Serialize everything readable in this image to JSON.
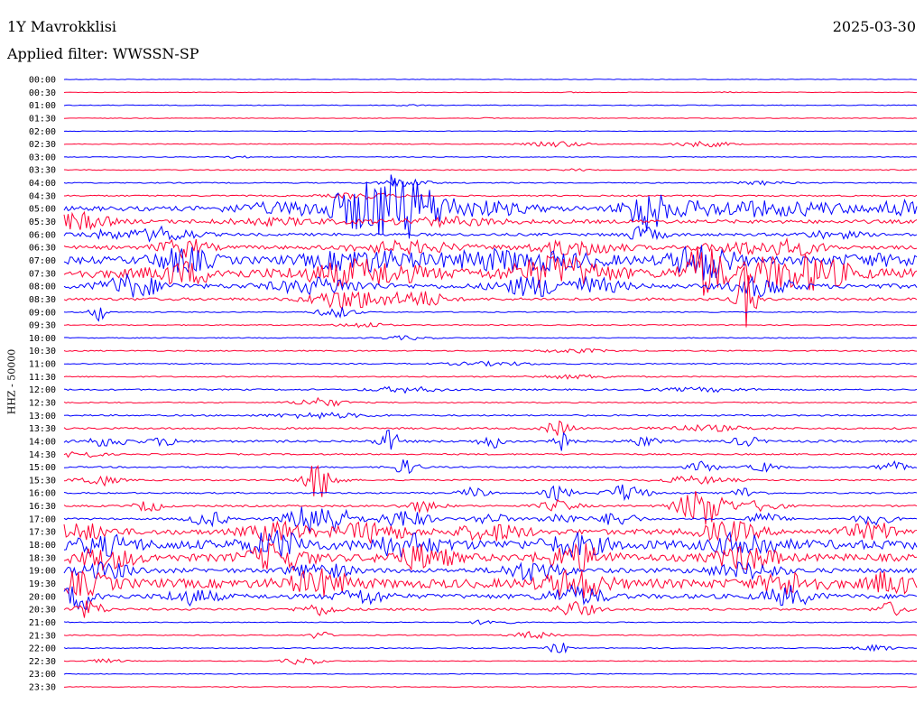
{
  "header": {
    "station": "1Y Mavrokklisi",
    "date": "2025-03-30",
    "filter": "Applied filter: WWSSN-SP"
  },
  "chart_data": {
    "type": "line",
    "ylabel": "HHZ - 50000",
    "tick_labels": [
      "00:00",
      "00:30",
      "01:00",
      "01:30",
      "02:00",
      "02:30",
      "03:00",
      "03:30",
      "04:00",
      "04:30",
      "05:00",
      "05:30",
      "06:00",
      "06:30",
      "07:00",
      "07:30",
      "08:00",
      "08:30",
      "09:00",
      "09:30",
      "10:00",
      "10:30",
      "11:00",
      "11:30",
      "12:00",
      "12:30",
      "13:00",
      "13:30",
      "14:00",
      "14:30",
      "15:00",
      "15:30",
      "16:00",
      "16:30",
      "17:00",
      "17:30",
      "18:00",
      "18:30",
      "19:00",
      "19:30",
      "20:00",
      "20:30",
      "21:00",
      "21:30",
      "22:00",
      "22:30",
      "23:00",
      "23:30"
    ],
    "series_colors": [
      "#0000ff",
      "#ff0033"
    ],
    "grid": false,
    "rows": [
      {
        "noise": 0.3,
        "events": []
      },
      {
        "noise": 0.3,
        "events": [
          [
            0.6,
            0.6,
            0.1
          ],
          [
            0.78,
            0.5,
            0.1
          ]
        ]
      },
      {
        "noise": 0.4,
        "events": [
          [
            0.4,
            1,
            0.2
          ]
        ]
      },
      {
        "noise": 0.3,
        "events": [
          [
            0.5,
            0.6,
            0.1
          ]
        ]
      },
      {
        "noise": 0.3,
        "events": []
      },
      {
        "noise": 0.4,
        "events": [
          [
            0.58,
            3,
            0.5
          ],
          [
            0.75,
            3,
            0.5
          ]
        ]
      },
      {
        "noise": 0.4,
        "events": [
          [
            0.2,
            1,
            0.3
          ]
        ]
      },
      {
        "noise": 0.5,
        "events": [
          [
            0.6,
            1,
            0.3
          ]
        ]
      },
      {
        "noise": 0.6,
        "events": [
          [
            0.4,
            4,
            0.4
          ],
          [
            0.82,
            2,
            0.4
          ]
        ]
      },
      {
        "noise": 0.8,
        "events": [
          [
            0.35,
            3,
            0.6
          ]
        ]
      },
      {
        "noise": 2.5,
        "events": [
          [
            0.24,
            4,
            0.8
          ],
          [
            0.35,
            8,
            1.2
          ],
          [
            0.38,
            26,
            0.8
          ],
          [
            0.42,
            8,
            0.7
          ],
          [
            0.5,
            6,
            0.8
          ],
          [
            0.68,
            22,
            0.3
          ],
          [
            0.72,
            6,
            0.8
          ],
          [
            0.8,
            6,
            0.8
          ],
          [
            0.88,
            5,
            0.8
          ],
          [
            0.98,
            8,
            0.4
          ]
        ]
      },
      {
        "noise": 2,
        "events": [
          [
            0.01,
            6,
            0.4
          ],
          [
            0.03,
            4,
            0.5
          ],
          [
            0.25,
            3,
            1
          ],
          [
            0.45,
            4,
            1
          ]
        ]
      },
      {
        "noise": 1.5,
        "events": [
          [
            0.05,
            4,
            0.5
          ],
          [
            0.12,
            8,
            0.5
          ],
          [
            0.68,
            8,
            0.3
          ],
          [
            0.9,
            4,
            0.5
          ]
        ]
      },
      {
        "noise": 2,
        "events": [
          [
            0.14,
            10,
            0.4
          ],
          [
            0.4,
            6,
            1
          ],
          [
            0.6,
            8,
            0.8
          ],
          [
            0.8,
            6,
            0.8
          ],
          [
            0.86,
            6,
            0.5
          ]
        ]
      },
      {
        "noise": 4,
        "events": [
          [
            0.14,
            12,
            0.5
          ],
          [
            0.35,
            10,
            1
          ],
          [
            0.5,
            8,
            1
          ],
          [
            0.58,
            6,
            1
          ],
          [
            0.75,
            20,
            0.5
          ],
          [
            0.95,
            4,
            1
          ]
        ]
      },
      {
        "noise": 5,
        "events": [
          [
            0.14,
            10,
            0.5
          ],
          [
            0.35,
            12,
            1
          ],
          [
            0.58,
            16,
            0.8
          ],
          [
            0.75,
            30,
            0.3
          ],
          [
            0.82,
            12,
            0.5
          ],
          [
            0.88,
            16,
            0.6
          ]
        ]
      },
      {
        "noise": 2.5,
        "events": [
          [
            0.08,
            12,
            0.5
          ],
          [
            0.3,
            8,
            0.8
          ],
          [
            0.55,
            10,
            0.6
          ],
          [
            0.62,
            8,
            0.5
          ],
          [
            0.82,
            10,
            0.5
          ]
        ]
      },
      {
        "noise": 1.5,
        "events": [
          [
            0.32,
            8,
            0.5
          ],
          [
            0.36,
            6,
            0.6
          ],
          [
            0.42,
            8,
            0.4
          ],
          [
            0.8,
            40,
            0.1
          ]
        ]
      },
      {
        "noise": 0.5,
        "events": [
          [
            0.04,
            10,
            0.1
          ],
          [
            0.32,
            6,
            0.3
          ]
        ]
      },
      {
        "noise": 0.5,
        "events": [
          [
            0.35,
            3,
            0.4
          ]
        ]
      },
      {
        "noise": 0.5,
        "events": [
          [
            0.4,
            2,
            0.4
          ]
        ]
      },
      {
        "noise": 0.6,
        "events": [
          [
            0.6,
            2,
            0.6
          ]
        ]
      },
      {
        "noise": 0.6,
        "events": [
          [
            0.5,
            2,
            0.8
          ]
        ]
      },
      {
        "noise": 0.6,
        "events": [
          [
            0.6,
            2,
            0.8
          ]
        ]
      },
      {
        "noise": 0.8,
        "events": [
          [
            0.4,
            3,
            0.6
          ],
          [
            0.75,
            2,
            0.8
          ]
        ]
      },
      {
        "noise": 0.6,
        "events": [
          [
            0.3,
            5,
            0.4
          ]
        ]
      },
      {
        "noise": 0.8,
        "events": [
          [
            0.3,
            3,
            0.8
          ]
        ]
      },
      {
        "noise": 1,
        "events": [
          [
            0.58,
            8,
            0.2
          ],
          [
            0.75,
            3,
            0.8
          ]
        ]
      },
      {
        "noise": 1.2,
        "events": [
          [
            0.05,
            5,
            0.4
          ],
          [
            0.12,
            5,
            0.2
          ],
          [
            0.38,
            12,
            0.15
          ],
          [
            0.5,
            8,
            0.15
          ],
          [
            0.58,
            12,
            0.15
          ],
          [
            0.68,
            5,
            0.2
          ],
          [
            0.8,
            5,
            0.2
          ]
        ]
      },
      {
        "noise": 0.8,
        "events": [
          [
            0.02,
            4,
            0.3
          ]
        ]
      },
      {
        "noise": 0.8,
        "events": [
          [
            0.4,
            8,
            0.2
          ],
          [
            0.75,
            6,
            0.2
          ],
          [
            0.82,
            5,
            0.2
          ],
          [
            0.97,
            6,
            0.2
          ]
        ]
      },
      {
        "noise": 0.8,
        "events": [
          [
            0.04,
            6,
            0.3
          ],
          [
            0.3,
            20,
            0.25
          ],
          [
            0.74,
            4,
            0.6
          ]
        ]
      },
      {
        "noise": 0.8,
        "events": [
          [
            0.48,
            6,
            0.2
          ],
          [
            0.58,
            8,
            0.2
          ],
          [
            0.66,
            10,
            0.3
          ],
          [
            0.8,
            6,
            0.2
          ]
        ]
      },
      {
        "noise": 1,
        "events": [
          [
            0.1,
            6,
            0.2
          ],
          [
            0.42,
            6,
            0.3
          ],
          [
            0.58,
            6,
            0.3
          ],
          [
            0.75,
            22,
            0.4
          ],
          [
            0.82,
            6,
            0.3
          ]
        ]
      },
      {
        "noise": 1,
        "events": [
          [
            0.17,
            8,
            0.3
          ],
          [
            0.3,
            20,
            0.5
          ],
          [
            0.4,
            10,
            0.4
          ],
          [
            0.5,
            6,
            0.3
          ],
          [
            0.58,
            6,
            0.3
          ],
          [
            0.65,
            8,
            0.3
          ],
          [
            0.82,
            6,
            0.3
          ],
          [
            0.95,
            6,
            0.3
          ]
        ]
      },
      {
        "noise": 3,
        "events": [
          [
            0.02,
            8,
            0.5
          ],
          [
            0.25,
            10,
            0.5
          ],
          [
            0.36,
            10,
            0.6
          ],
          [
            0.5,
            8,
            0.6
          ],
          [
            0.78,
            10,
            0.5
          ],
          [
            0.95,
            8,
            0.5
          ]
        ]
      },
      {
        "noise": 5,
        "events": [
          [
            0.05,
            8,
            0.5
          ],
          [
            0.25,
            12,
            0.5
          ],
          [
            0.4,
            10,
            0.6
          ],
          [
            0.6,
            10,
            0.5
          ],
          [
            0.8,
            12,
            0.5
          ]
        ]
      },
      {
        "noise": 4,
        "events": [
          [
            0.05,
            10,
            0.5
          ],
          [
            0.25,
            14,
            0.5
          ],
          [
            0.42,
            12,
            0.5
          ],
          [
            0.6,
            14,
            0.5
          ],
          [
            0.8,
            12,
            0.5
          ]
        ]
      },
      {
        "noise": 2.5,
        "events": [
          [
            0.05,
            8,
            0.5
          ],
          [
            0.3,
            8,
            0.5
          ],
          [
            0.55,
            10,
            0.5
          ],
          [
            0.8,
            8,
            0.6
          ]
        ]
      },
      {
        "noise": 5,
        "events": [
          [
            0.02,
            10,
            0.5
          ],
          [
            0.3,
            12,
            0.5
          ],
          [
            0.6,
            14,
            0.5
          ],
          [
            0.85,
            10,
            0.5
          ],
          [
            0.97,
            12,
            0.3
          ]
        ]
      },
      {
        "noise": 2.5,
        "events": [
          [
            0.02,
            14,
            0.3
          ],
          [
            0.15,
            8,
            0.4
          ],
          [
            0.35,
            8,
            0.4
          ],
          [
            0.6,
            10,
            0.5
          ],
          [
            0.85,
            10,
            0.4
          ]
        ]
      },
      {
        "noise": 1.2,
        "events": [
          [
            0.03,
            10,
            0.2
          ],
          [
            0.3,
            6,
            0.3
          ],
          [
            0.6,
            8,
            0.3
          ],
          [
            0.97,
            8,
            0.2
          ]
        ]
      },
      {
        "noise": 0.5,
        "events": [
          [
            0.5,
            3,
            0.3
          ]
        ]
      },
      {
        "noise": 0.5,
        "events": [
          [
            0.3,
            6,
            0.1
          ],
          [
            0.55,
            4,
            0.3
          ]
        ]
      },
      {
        "noise": 0.5,
        "events": [
          [
            0.58,
            8,
            0.1
          ],
          [
            0.95,
            3,
            0.3
          ]
        ]
      },
      {
        "noise": 0.4,
        "events": [
          [
            0.05,
            2,
            0.3
          ],
          [
            0.28,
            4,
            0.3
          ]
        ]
      },
      {
        "noise": 0.4,
        "events": []
      },
      {
        "noise": 0.4,
        "events": []
      }
    ]
  }
}
